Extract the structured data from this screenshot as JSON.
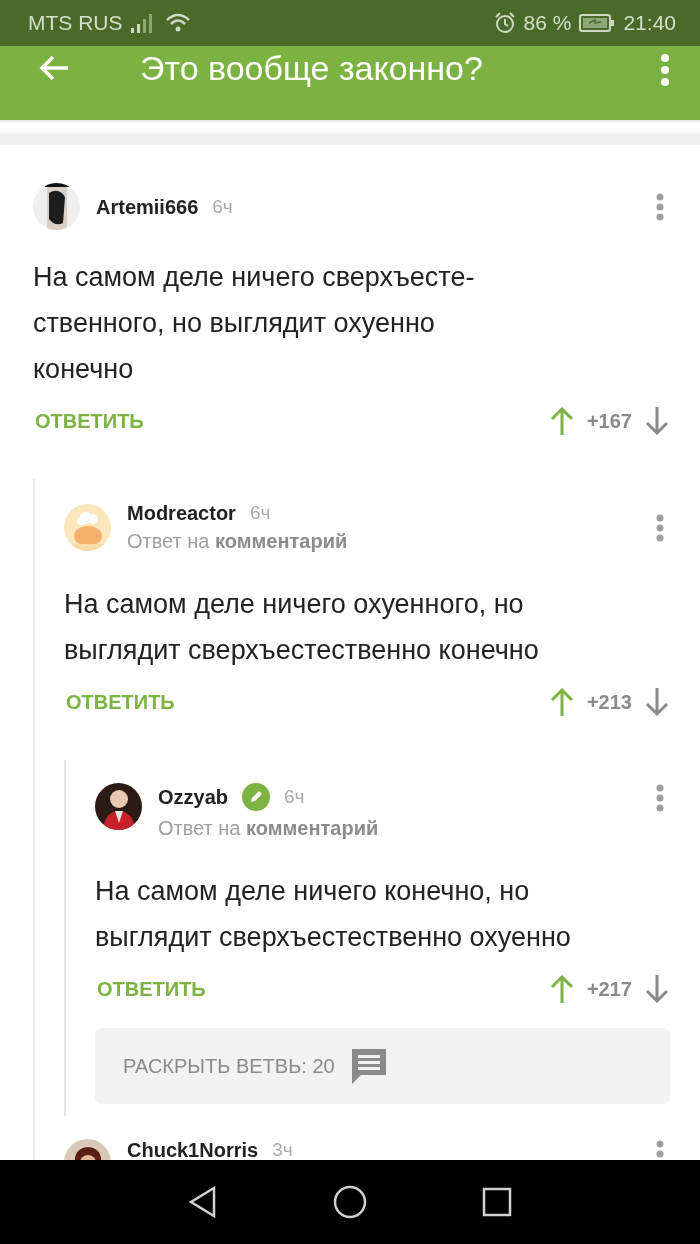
{
  "status_bar": {
    "carrier": "MTS RUS",
    "battery": "86 %",
    "time": "21:40"
  },
  "app_bar": {
    "title": "Это вообще законно?"
  },
  "comments": [
    {
      "author": "Artemii666",
      "time": "6ч",
      "avatar": {
        "kind": "picture"
      },
      "verified": false,
      "text": "На самом деле ничего сверхъесте-\nственного, но выглядит охуенно\nконечно",
      "reply_label": "ОТВЕТИТЬ",
      "score": "+167",
      "children": [
        {
          "author": "Modreactor",
          "time": "6ч",
          "avatar": {
            "kind": "picture"
          },
          "verified": false,
          "reply_to": "Ответ на **комментарий**",
          "text": "На самом деле ничего охуенного, но\nвыглядит сверхъестественно конечно",
          "reply_label": "ОТВЕТИТЬ",
          "score": "+213",
          "children": [
            {
              "author": "Ozzyab",
              "time": "6ч",
              "avatar": {
                "kind": "picture"
              },
              "verified": true,
              "reply_to": "Ответ на **комментарий**",
              "text": "На самом деле ничего конечно, но\nвыглядит сверхъестественно охуенно",
              "reply_label": "ОТВЕТИТЬ",
              "score": "+217",
              "expand": "РАСКРЫТЬ ВЕТВЬ: 20"
            }
          ]
        },
        {
          "author": "Chuck1Norris",
          "time": "3ч",
          "avatar": {
            "kind": "picture"
          },
          "verified": false
        }
      ]
    }
  ]
}
